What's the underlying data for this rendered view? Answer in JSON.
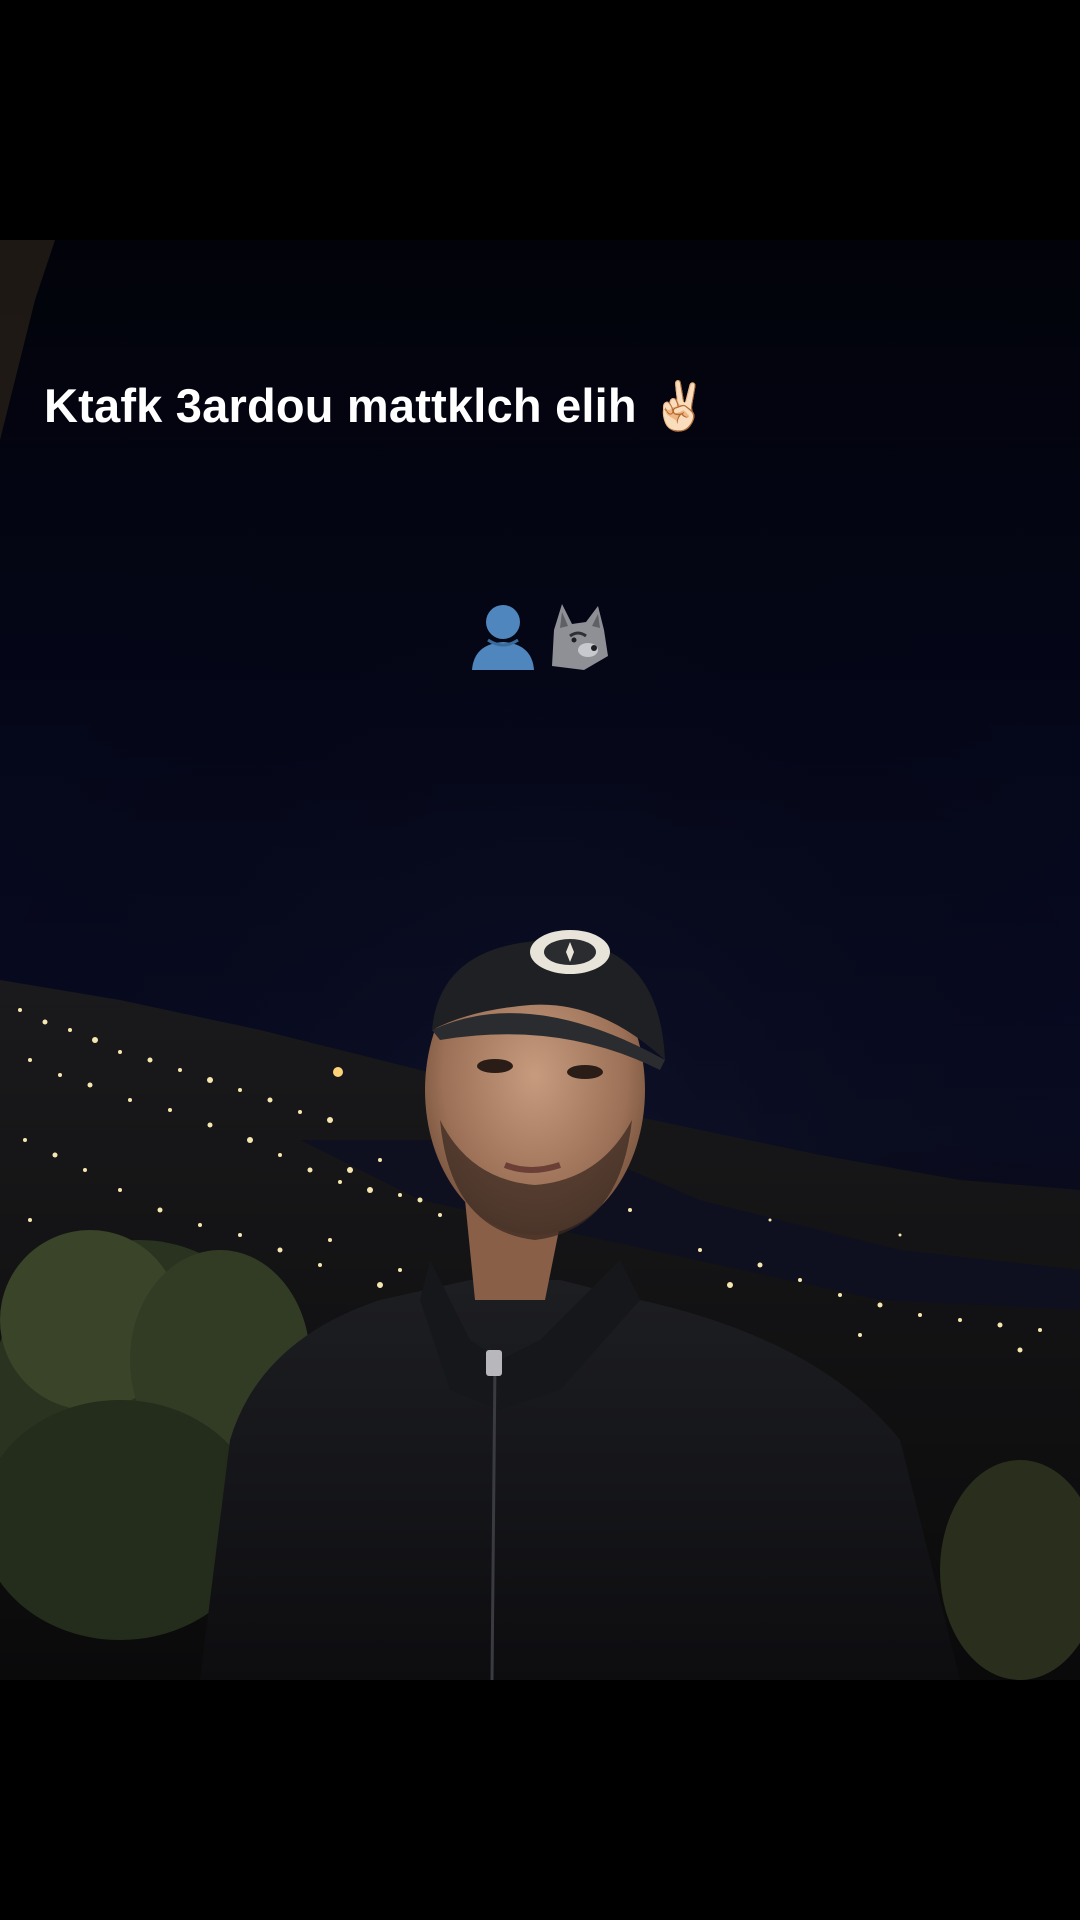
{
  "caption": {
    "text": "Ktafk 3ardou mattklch elih ✌🏻"
  },
  "sticker_row": {
    "icons": [
      "bust-silhouette-icon",
      "wolf-icon"
    ]
  },
  "colors": {
    "background": "#000000",
    "night_sky": "#05071a",
    "city_lights": "#f6e7b0",
    "caption_text": "#ffffff",
    "silhouette_blue": "#4f86bd"
  }
}
